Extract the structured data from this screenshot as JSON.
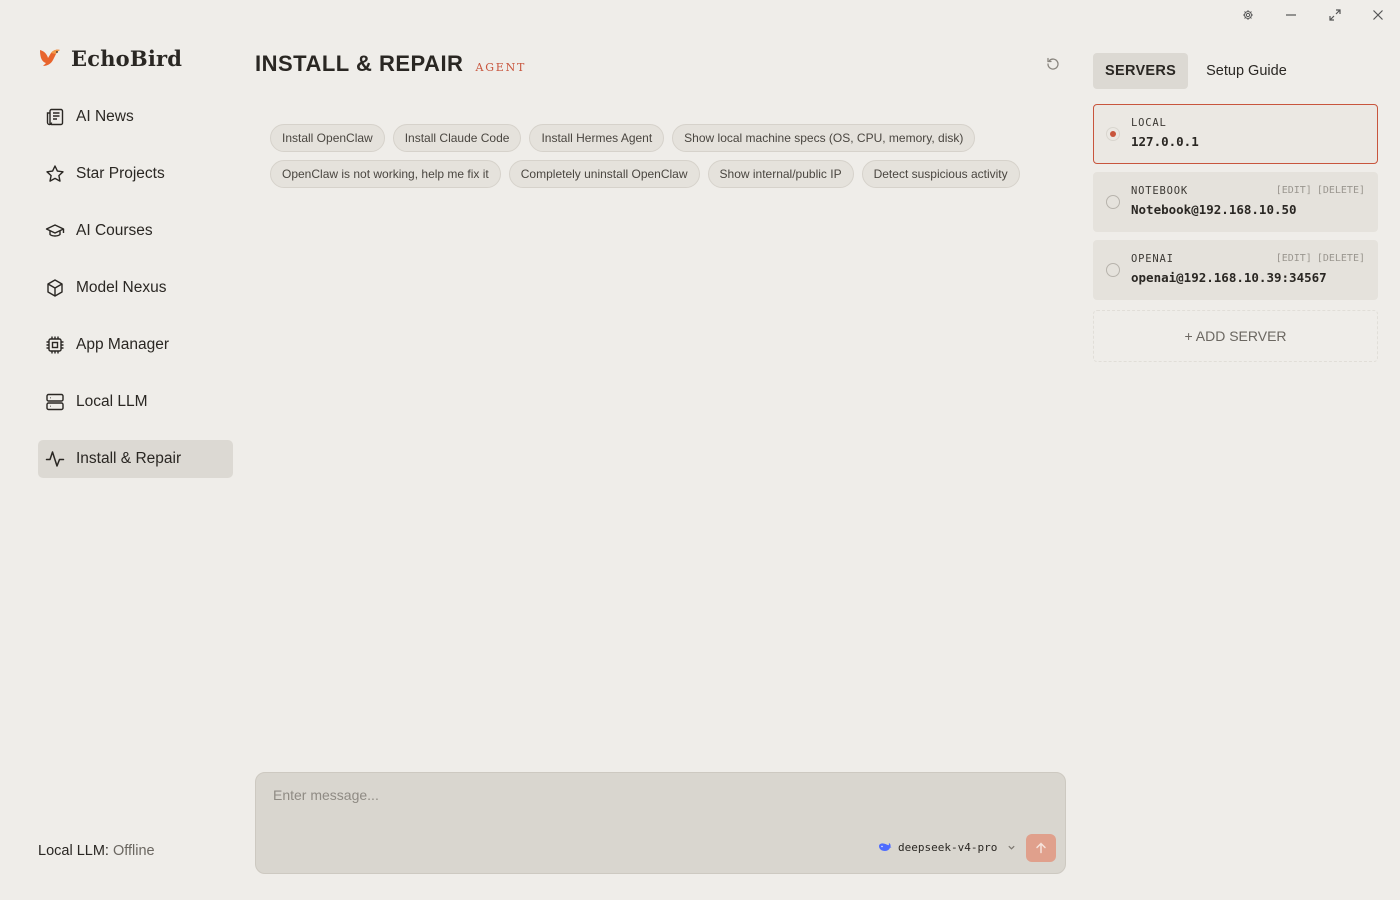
{
  "app": {
    "name": "EchoBird"
  },
  "sidebar": {
    "items": [
      {
        "label": "AI News",
        "icon": "newspaper-icon",
        "active": false
      },
      {
        "label": "Star Projects",
        "icon": "star-icon",
        "active": false
      },
      {
        "label": "AI Courses",
        "icon": "graduation-cap-icon",
        "active": false
      },
      {
        "label": "Model Nexus",
        "icon": "cube-icon",
        "active": false
      },
      {
        "label": "App Manager",
        "icon": "cpu-chip-icon",
        "active": false
      },
      {
        "label": "Local LLM",
        "icon": "server-icon",
        "active": false
      },
      {
        "label": "Install & Repair",
        "icon": "activity-pulse-icon",
        "active": true
      }
    ],
    "status": {
      "label": "Local LLM:",
      "value": "Offline"
    }
  },
  "main": {
    "title": "INSTALL & REPAIR",
    "badge": "AGENT",
    "suggestions": [
      "Install OpenClaw",
      "Install Claude Code",
      "Install Hermes Agent",
      "Show local machine specs (OS, CPU, memory, disk)",
      "OpenClaw is not working, help me fix it",
      "Completely uninstall OpenClaw",
      "Show internal/public IP",
      "Detect suspicious activity"
    ],
    "composer": {
      "placeholder": "Enter message...",
      "model": "deepseek-v4-pro"
    }
  },
  "right_panel": {
    "tabs": [
      {
        "label": "SERVERS",
        "active": true
      },
      {
        "label": "Setup Guide",
        "active": false
      }
    ],
    "servers": [
      {
        "name": "LOCAL",
        "address": "127.0.0.1",
        "selected": true,
        "editable": false
      },
      {
        "name": "NOTEBOOK",
        "address": "Notebook@192.168.10.50",
        "selected": false,
        "editable": true
      },
      {
        "name": "OPENAI",
        "address": "openai@192.168.10.39:34567",
        "selected": false,
        "editable": true
      }
    ],
    "edit_label": "[EDIT]",
    "delete_label": "[DELETE]",
    "add_server_label": "+ ADD SERVER"
  },
  "colors": {
    "accent": "#c8553d",
    "background": "#efede9",
    "active_bg": "#dcd9d3"
  }
}
